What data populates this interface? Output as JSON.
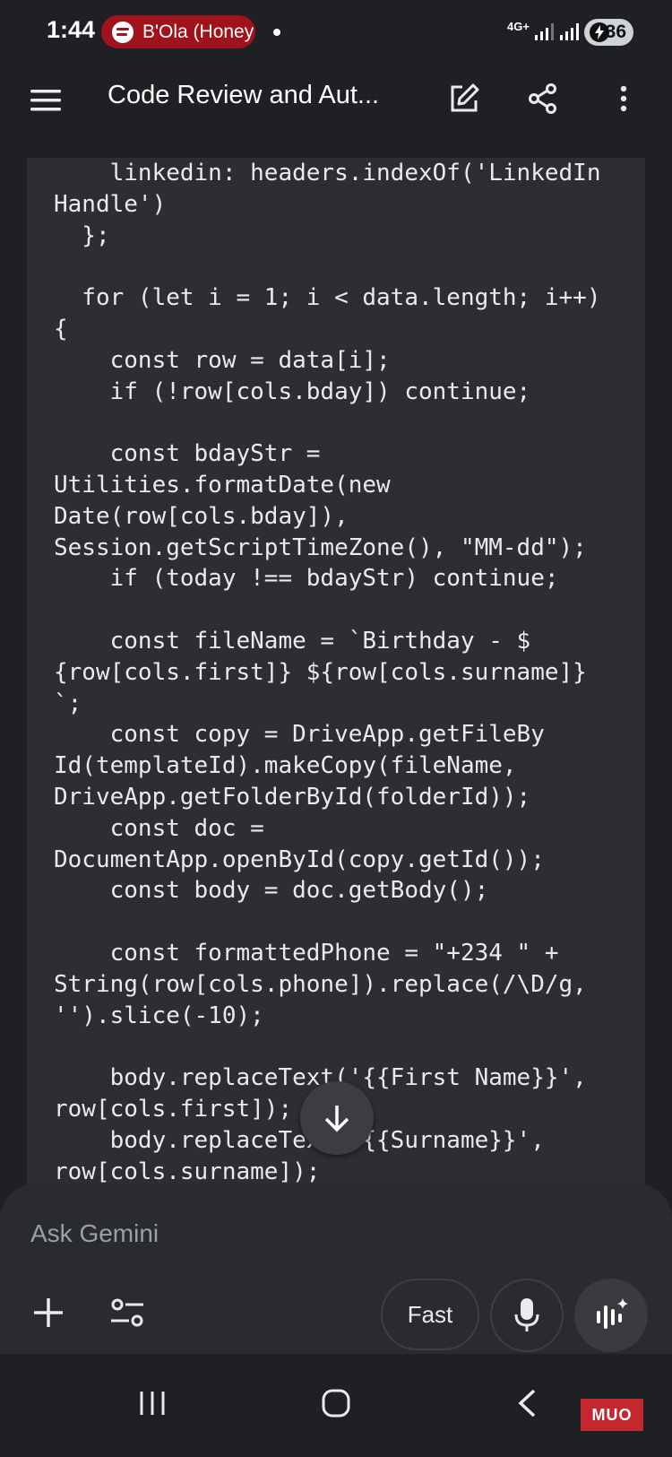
{
  "status": {
    "time": "1:44",
    "media_title": "B'Ola (Honey",
    "network": "4G+",
    "battery": "36"
  },
  "app_bar": {
    "title": "Code Review and Aut...",
    "icons": [
      "menu-icon",
      "edit-icon",
      "share-icon",
      "more-vert-icon"
    ]
  },
  "code": {
    "lines": [
      "    linkedin: headers.indexOf('LinkedIn",
      "Handle')",
      "  };",
      "",
      "  for (let i = 1; i < data.length; i++)",
      "{",
      "    const row = data[i];",
      "    if (!row[cols.bday]) continue;",
      "",
      "    const bdayStr =",
      "Utilities.formatDate(new",
      "Date(row[cols.bday]),",
      "Session.getScriptTimeZone(), \"MM-dd\");",
      "    if (today !== bdayStr) continue;",
      "",
      "    const fileName = `Birthday - $",
      "{row[cols.first]} ${row[cols.surname]}",
      "`;",
      "    const copy = DriveApp.getFileBy",
      "Id(templateId).makeCopy(fileName,",
      "DriveApp.getFolderById(folderId));",
      "    const doc =",
      "DocumentApp.openById(copy.getId());",
      "    const body = doc.getBody();",
      "",
      "    const formattedPhone = \"+234 \" +",
      "String(row[cols.phone]).replace(/\\D/g,",
      "'').slice(-10);",
      "",
      "    body.replaceText('{{First Name}}',",
      "row[cols.first]);",
      "    body.replaceText('{{Surname}}',",
      "row[cols.surname]);"
    ]
  },
  "input": {
    "placeholder": "Ask Gemini",
    "mode_label": "Fast"
  },
  "watermark": "MUO"
}
